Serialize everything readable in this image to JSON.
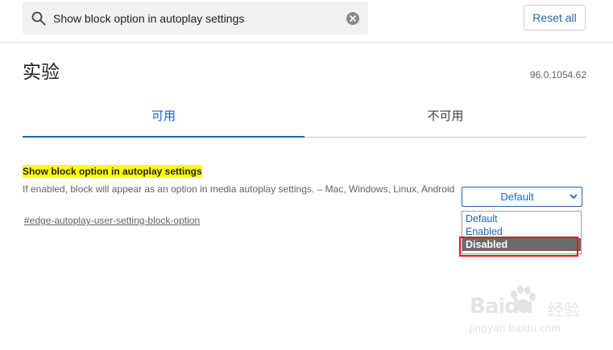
{
  "search": {
    "value": "Show block option in autoplay settings",
    "reset_label": "Reset all"
  },
  "header": {
    "title": "实验",
    "version": "96.0.1054.62"
  },
  "tabs": [
    {
      "label": "可用",
      "active": true
    },
    {
      "label": "不可用",
      "active": false
    }
  ],
  "experiment": {
    "title": "Show block option in autoplay settings",
    "description": "If enabled, block will appear as an option in media autoplay settings. – Mac, Windows, Linux, Android",
    "link": "#edge-autoplay-user-setting-block-option",
    "selected": "Default",
    "options": [
      "Default",
      "Enabled",
      "Disabled"
    ],
    "highlighted_option": "Disabled"
  },
  "watermark": {
    "brand": "Baidu",
    "product": "经验",
    "url": "jingyan.baidu.com"
  },
  "colors": {
    "accent": "#1a66b8",
    "highlight_yellow": "#ffff00",
    "annotation_red": "#e5161f",
    "selected_option_bg": "#6b6b6b"
  }
}
